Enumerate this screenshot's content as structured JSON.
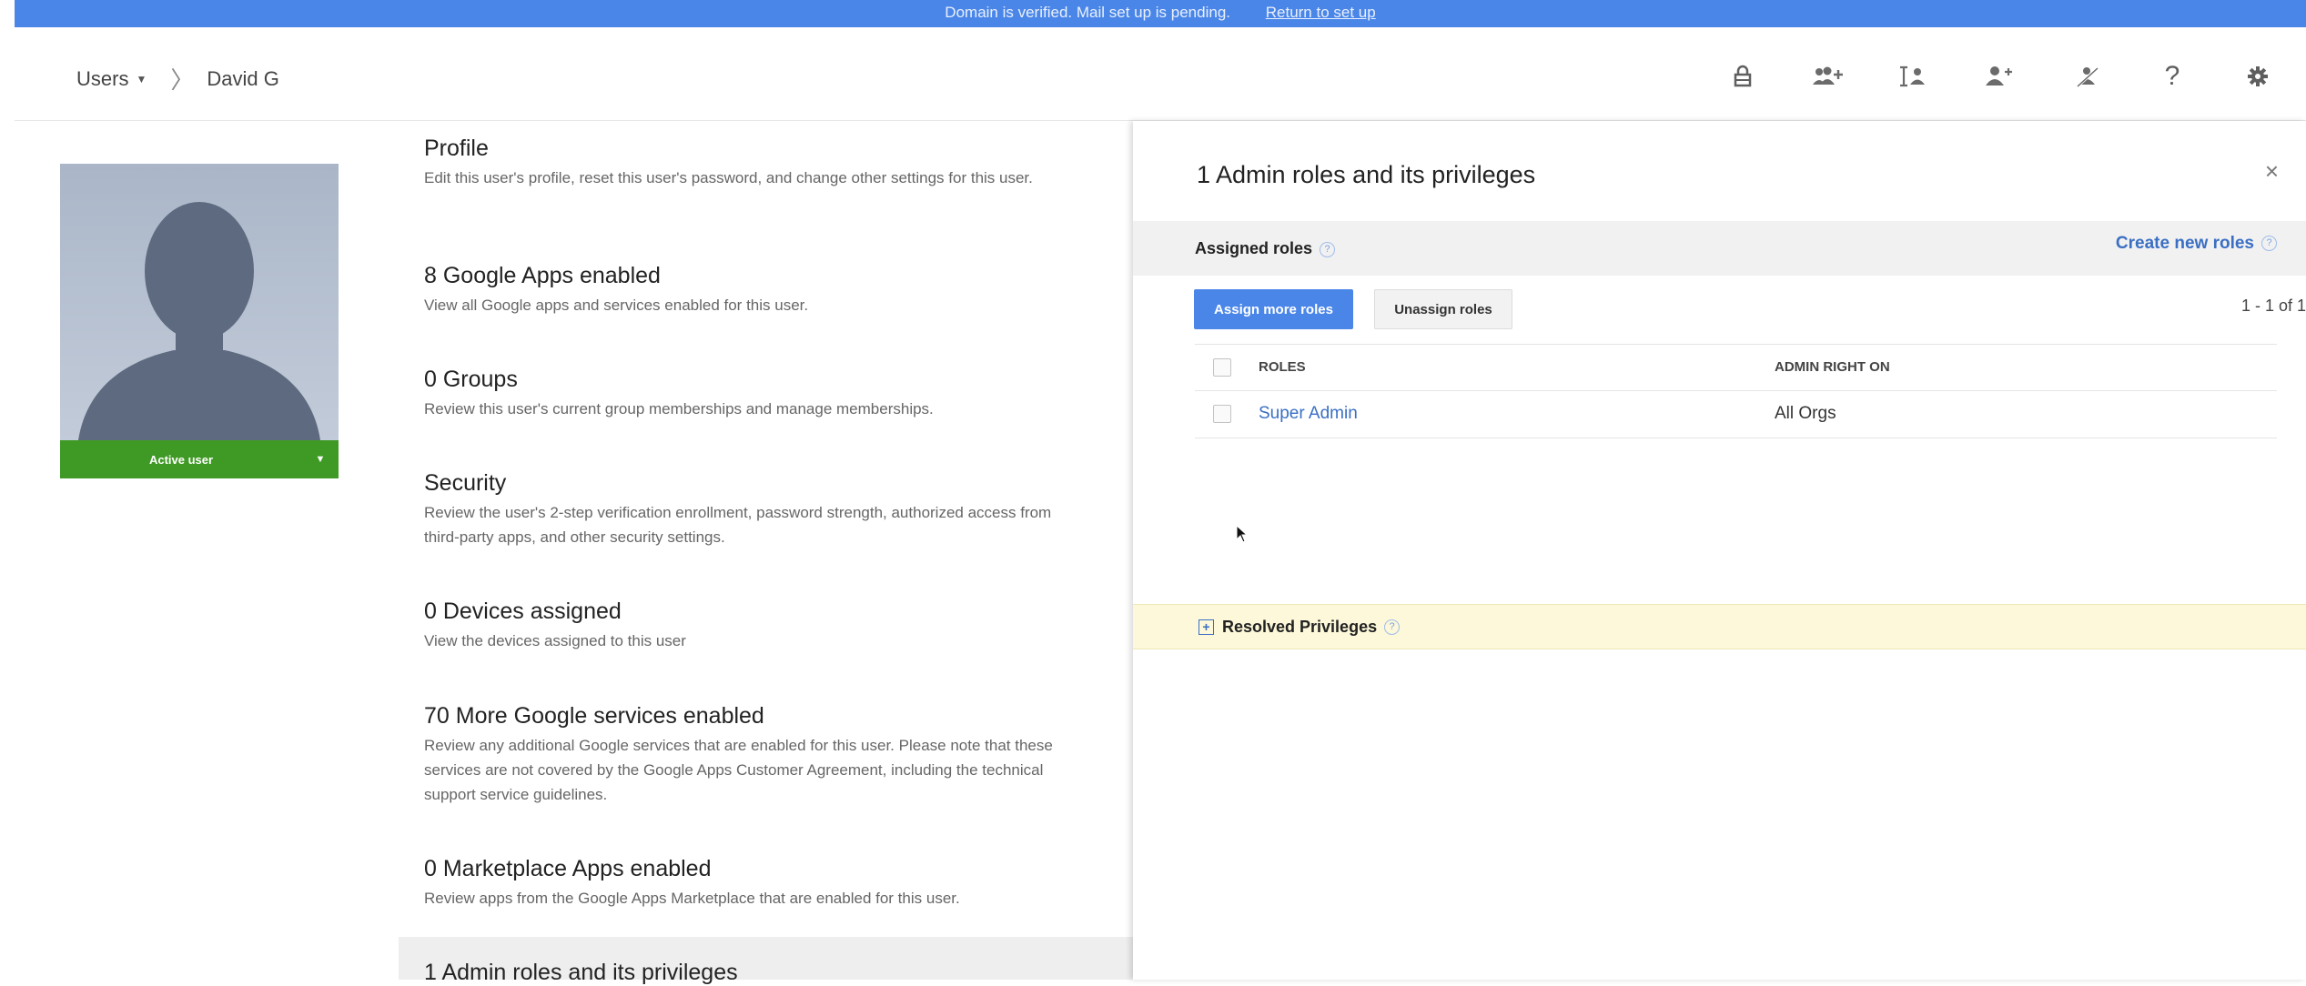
{
  "banner": {
    "text": "Domain is verified. Mail set up is pending.",
    "link": "Return to set up"
  },
  "breadcrumb": {
    "users": "Users",
    "current": "David G"
  },
  "header_icons": [
    "lock-icon",
    "add-group-icon",
    "rename-user-icon",
    "add-user-icon",
    "suspend-user-icon",
    "help-icon",
    "settings-icon"
  ],
  "user": {
    "status": "Active user"
  },
  "sections": [
    {
      "title": "Profile",
      "desc": "Edit this user's profile, reset this user's password, and change other settings for this user."
    },
    {
      "title": "8 Google Apps enabled",
      "desc": "View all Google apps and services enabled for this user."
    },
    {
      "title": "0 Groups",
      "desc": "Review this user's current group memberships and manage memberships."
    },
    {
      "title": "Security",
      "desc": "Review the user's 2-step verification enrollment, password strength, authorized access from third-party apps, and other security settings."
    },
    {
      "title": "0 Devices assigned",
      "desc": "View the devices assigned to this user"
    },
    {
      "title": "70 More Google services enabled",
      "desc": "Review any additional Google services that are enabled for this user. Please note that these services are not covered by the Google Apps Customer Agreement, including the technical support service guidelines."
    },
    {
      "title": "0 Marketplace Apps enabled",
      "desc": "Review apps from the Google Apps Marketplace that are enabled for this user."
    },
    {
      "title": "1 Admin roles and its privileges",
      "desc": ""
    }
  ],
  "panel": {
    "title": "1 Admin roles and its privileges",
    "close": "×",
    "assigned_label": "Assigned roles",
    "create_link": "Create new roles",
    "assign_button": "Assign more roles",
    "unassign_button": "Unassign roles",
    "pager": "1 - 1 of 1",
    "columns": [
      "ROLES",
      "ADMIN RIGHT ON"
    ],
    "rows": [
      {
        "role": "Super Admin",
        "right_on": "All Orgs"
      }
    ],
    "resolved_label": "Resolved Privileges",
    "help_glyph": "?"
  },
  "colors": {
    "accent": "#4a86e8",
    "active_user": "#3f9a25",
    "link": "#3a6fc4",
    "resolved_bg": "#fcf8d9"
  }
}
